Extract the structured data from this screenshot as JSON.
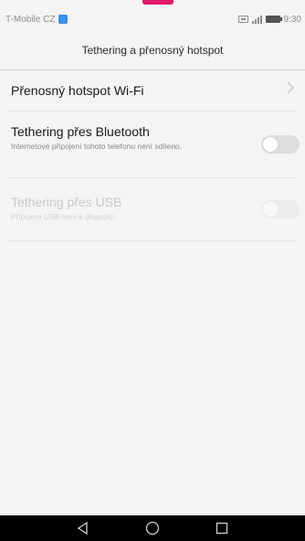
{
  "status_bar": {
    "carrier": "T-Mobile CZ",
    "time": "9:30",
    "icons": [
      "notification-icon",
      "sim-icon",
      "signal-icon",
      "battery-icon"
    ]
  },
  "header": {
    "title": "Tethering a přenosný hotspot"
  },
  "settings": {
    "items": [
      {
        "label": "Přenosný hotspot Wi-Fi",
        "control": "chevron-right-icon"
      },
      {
        "label": "Tethering přes Bluetooth",
        "sublabel": "Internetové připojení tohoto telefonu není sdíleno.",
        "toggle_state": "off"
      },
      {
        "label": "Tethering přes USB",
        "sublabel": "Připojení USB není k dispozici",
        "toggle_state": "off",
        "enabled": false
      }
    ]
  },
  "nav_bar": {
    "buttons": [
      "back-icon",
      "home-icon",
      "recents-icon"
    ]
  },
  "colors": {
    "background": "#f4f4f4",
    "accent_indicator": "#e0186c",
    "nav_background": "#000000"
  }
}
